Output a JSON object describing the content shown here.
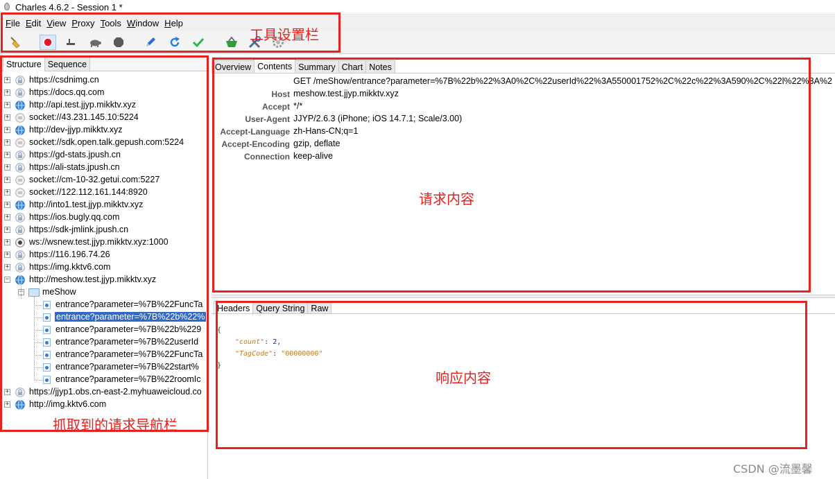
{
  "window": {
    "title": "Charles 4.6.2 - Session 1 *"
  },
  "menu": [
    {
      "label": "File",
      "mnemonic": "F",
      "rest": "ile"
    },
    {
      "label": "Edit",
      "mnemonic": "E",
      "rest": "dit"
    },
    {
      "label": "View",
      "mnemonic": "V",
      "rest": "iew"
    },
    {
      "label": "Proxy",
      "mnemonic": "P",
      "rest": "roxy"
    },
    {
      "label": "Tools",
      "mnemonic": "T",
      "rest": "ools"
    },
    {
      "label": "Window",
      "mnemonic": "W",
      "rest": "indow"
    },
    {
      "label": "Help",
      "mnemonic": "H",
      "rest": "elp"
    }
  ],
  "toolbar": {
    "tools": [
      {
        "name": "broom-icon",
        "color": "#e2b23a"
      },
      {
        "name": "record-icon",
        "color": "#e0182a",
        "active": true
      },
      {
        "name": "throttle-icon",
        "color": "#555555"
      },
      {
        "name": "turtle-icon",
        "color": "#6b6b6b"
      },
      {
        "name": "stop-icon",
        "color": "#5a5a5a"
      },
      {
        "name": "pen-icon",
        "color": "#2b6fd6"
      },
      {
        "name": "refresh-icon",
        "color": "#1f7fe0"
      },
      {
        "name": "check-icon",
        "color": "#2eb24a"
      },
      {
        "name": "basket-icon",
        "color": "#2a9f3a"
      },
      {
        "name": "tools-icon",
        "color": "#3b6fb0"
      },
      {
        "name": "gear-icon",
        "color": "#9a9a9a"
      }
    ]
  },
  "left_tabs": [
    "Structure",
    "Sequence"
  ],
  "tree": {
    "hosts_top": [
      {
        "label": "https://csdnimg.cn",
        "type": "lock"
      },
      {
        "label": "https://docs.qq.com",
        "type": "lock"
      },
      {
        "label": "http://api.test.jjyp.mikktv.xyz",
        "type": "globe"
      },
      {
        "label": "socket://43.231.145.10:5224",
        "type": "plain"
      },
      {
        "label": "http://dev-jjyp.mikktv.xyz",
        "type": "globe"
      },
      {
        "label": "socket://sdk.open.talk.gepush.com:5224",
        "type": "plain"
      },
      {
        "label": "https://gd-stats.jpush.cn",
        "type": "lock"
      },
      {
        "label": "https://ali-stats.jpush.cn",
        "type": "lock"
      },
      {
        "label": "socket://cm-10-32.getui.com:5227",
        "type": "plain"
      },
      {
        "label": "socket://122.112.161.144:8920",
        "type": "plain"
      },
      {
        "label": "http://into1.test.jjyp.mikktv.xyz",
        "type": "globe"
      },
      {
        "label": "https://ios.bugly.qq.com",
        "type": "lock"
      },
      {
        "label": "https://sdk-jmlink.jpush.cn",
        "type": "lock"
      },
      {
        "label": "ws://wsnew.test.jjyp.mikktv.xyz:1000",
        "type": "ws"
      },
      {
        "label": "https://116.196.74.26",
        "type": "lock"
      },
      {
        "label": "https://img.kktv6.com",
        "type": "lock"
      }
    ],
    "expanded_host": {
      "label": "http://meshow.test.jjyp.mikktv.xyz",
      "type": "globe"
    },
    "folder": {
      "label": "meShow"
    },
    "requests": [
      {
        "label": "entrance?parameter=%7B%22FuncTa",
        "selected": false
      },
      {
        "label": "entrance?parameter=%7B%22b%22%",
        "selected": true
      },
      {
        "label": "entrance?parameter=%7B%22b%229",
        "selected": false
      },
      {
        "label": "entrance?parameter=%7B%22userId",
        "selected": false
      },
      {
        "label": "entrance?parameter=%7B%22FuncTa",
        "selected": false
      },
      {
        "label": "entrance?parameter=%7B%22start%",
        "selected": false
      },
      {
        "label": "entrance?parameter=%7B%22roomIc",
        "selected": false
      }
    ],
    "hosts_bottom": [
      {
        "label": "https://jjyp1.obs.cn-east-2.myhuaweicloud.co",
        "type": "lock"
      },
      {
        "label": "http://img.kktv6.com",
        "type": "globe"
      }
    ]
  },
  "right_tabs": [
    "Overview",
    "Contents",
    "Summary",
    "Chart",
    "Notes"
  ],
  "request_line": "GET /meShow/entrance?parameter=%7B%22b%22%3A0%2C%22userId%22%3A550001752%2C%22c%22%3A590%2C%22l%22%3A%2",
  "request_headers": [
    {
      "key": "Host",
      "value": "meshow.test.jjyp.mikktv.xyz"
    },
    {
      "key": "Accept",
      "value": "*/*"
    },
    {
      "key": "User-Agent",
      "value": "JJYP/2.6.3 (iPhone; iOS 14.7.1; Scale/3.00)"
    },
    {
      "key": "Accept-Language",
      "value": "zh-Hans-CN;q=1"
    },
    {
      "key": "Accept-Encoding",
      "value": "gzip, deflate"
    },
    {
      "key": "Connection",
      "value": "keep-alive"
    }
  ],
  "response_tabs": [
    "Headers",
    "Query String",
    "Raw"
  ],
  "response_json": {
    "open": "{",
    "k1": "\"count\"",
    "v1": "2",
    "k2": "\"TagCode\"",
    "v2": "\"00000000\"",
    "close": "}"
  },
  "annotations": {
    "toolbar": "工具设置栏",
    "request": "请求内容",
    "response": "响应内容",
    "nav": "抓取到的请求导航栏",
    "color": "#e8201e"
  },
  "watermark": "CSDN @流墨馨"
}
